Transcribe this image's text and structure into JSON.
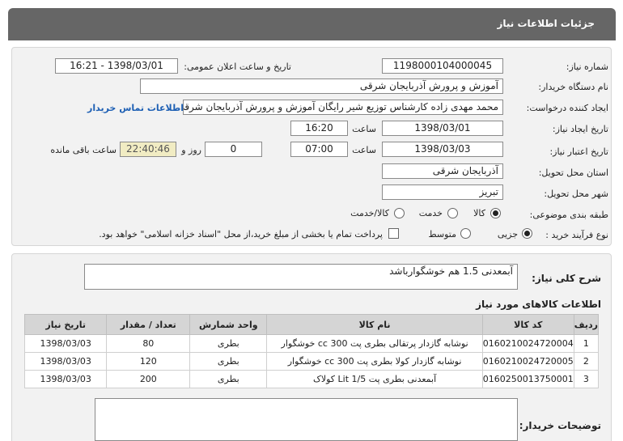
{
  "header": {
    "title": "جزئیات اطلاعات نیاز"
  },
  "fields": {
    "need_number": {
      "label": "شماره نیاز:",
      "value": "1198000104000045"
    },
    "announce": {
      "label": "تاریخ و ساعت اعلان عمومی:",
      "value": "1398/03/01 - 16:21"
    },
    "buyer_org": {
      "label": "نام دستگاه خریدار:",
      "value": "آموزش و پرورش آذربایجان شرقی"
    },
    "requester": {
      "label": "ایجاد کننده درخواست:",
      "value": "محمد مهدی زاده کارشناس توزیع شیر رایگان آموزش و پرورش آذربایجان شرقی",
      "contact_link": "اطلاعات تماس خریدار"
    },
    "created": {
      "label": "تاریخ ایجاد نیاز:",
      "date": "1398/03/01",
      "time_label": "ساعت",
      "time": "16:20"
    },
    "validity": {
      "label": "تاریخ اعتبار نیاز:",
      "date": "1398/03/03",
      "time_label": "ساعت",
      "time": "07:00",
      "days": "0",
      "days_label": "روز و",
      "remaining": "22:40:46",
      "remaining_label": "ساعت باقی مانده"
    },
    "province": {
      "label": "استان محل تحویل:",
      "value": "آذربایجان شرقی"
    },
    "city": {
      "label": "شهر محل تحویل:",
      "value": "تبریز"
    },
    "category": {
      "label": "طبقه بندی موضوعی:",
      "options": [
        "کالا",
        "خدمت",
        "کالا/خدمت"
      ],
      "selected": "کالا"
    },
    "process": {
      "label": "نوع فرآیند خرید :",
      "options": [
        "جزیی",
        "متوسط"
      ],
      "selected": "جزیی",
      "note": "پرداخت تمام یا بخشی از مبلغ خرید،از محل \"اسناد خزانه اسلامی\" خواهد بود."
    }
  },
  "general_desc": {
    "label": "شرح کلی نیاز:",
    "value": "آبمعدنی 1.5 هم خوشگوارباشد"
  },
  "goods": {
    "title": "اطلاعات کالاهای مورد نیاز",
    "columns": [
      "ردیف",
      "کد کالا",
      "نام کالا",
      "واحد شمارش",
      "تعداد / مقدار",
      "تاریخ نیاز"
    ],
    "rows": [
      [
        "1",
        "0160210024720004",
        "نوشابه گازدار پرتقالی بطری پت 300 cc خوشگوار",
        "بطری",
        "80",
        "1398/03/03"
      ],
      [
        "2",
        "0160210024720005",
        "نوشابه گازدار کولا بطری پت 300 cc خوشگوار",
        "بطری",
        "120",
        "1398/03/03"
      ],
      [
        "3",
        "0160250013750001",
        "آبمعدنی بطری پت 1/5 Lit کولاک",
        "بطری",
        "200",
        "1398/03/03"
      ]
    ]
  },
  "buyer_notes": {
    "label": "توضیحات خریدار:"
  }
}
